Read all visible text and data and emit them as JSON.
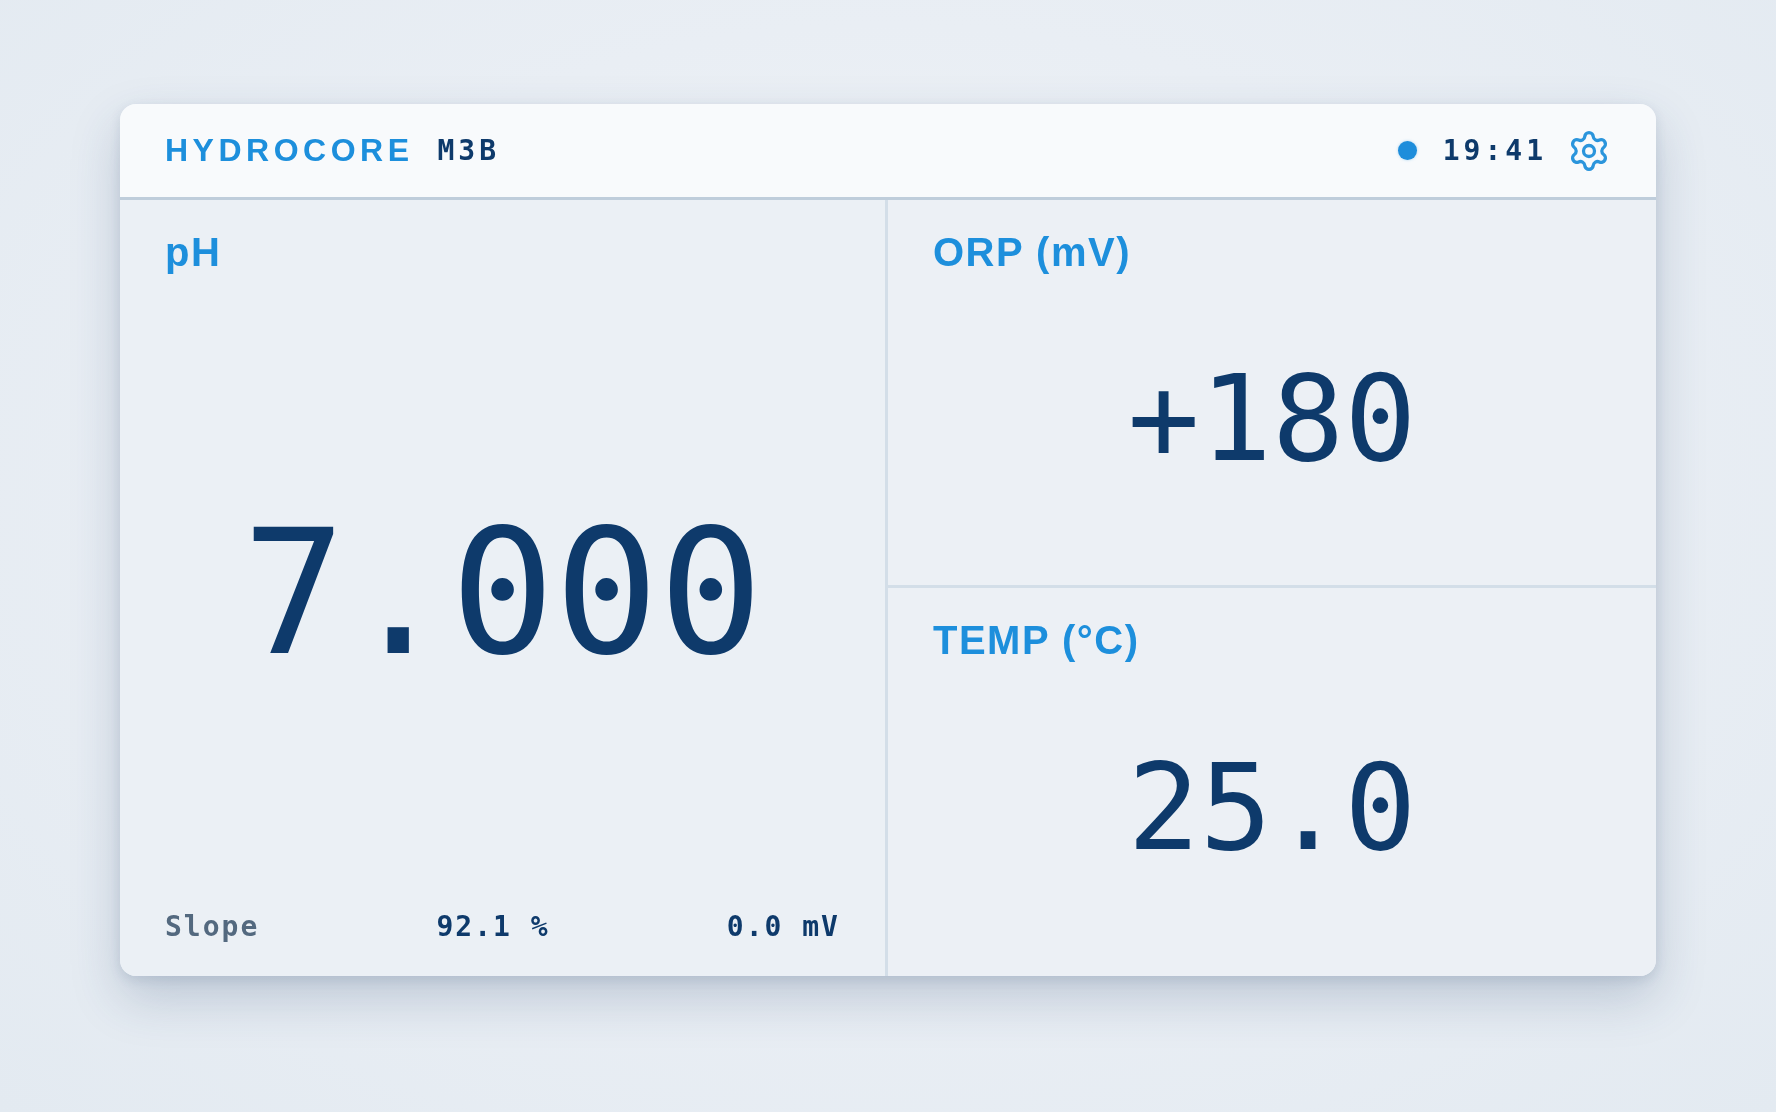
{
  "header": {
    "brand": "HYDROCORE",
    "model": "M3B",
    "indicator": {
      "on": true
    },
    "time": "19:41"
  },
  "main_panel": {
    "label": "pH",
    "value": "7.000",
    "footer": [
      {
        "kind": "label",
        "text": "Slope"
      },
      {
        "kind": "value",
        "text": "92.1 %"
      },
      {
        "kind": "value",
        "text": "0.0 mV"
      }
    ]
  },
  "side_panels": [
    {
      "label": "ORP (mV)",
      "value": "+180"
    },
    {
      "label": "TEMP (°C)",
      "value": "25.0"
    }
  ]
}
